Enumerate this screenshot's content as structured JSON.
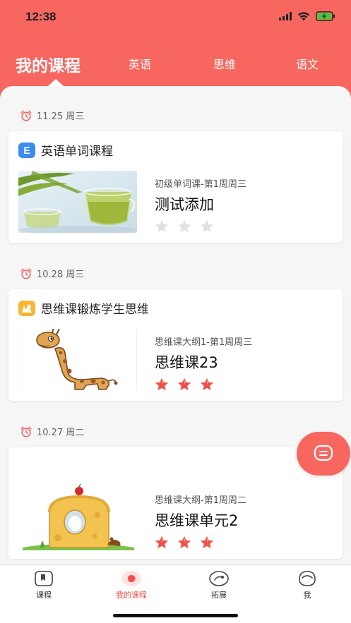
{
  "status_bar": {
    "time": "12:38"
  },
  "tabs": [
    {
      "label": "我的课程",
      "active": true
    },
    {
      "label": "英语",
      "active": false
    },
    {
      "label": "思维",
      "active": false
    },
    {
      "label": "语文",
      "active": false
    }
  ],
  "colors": {
    "brand": "#f7675f",
    "active_nav": "#f0524a",
    "star_filled": "#f0524a",
    "star_empty": "#e1e1e1"
  },
  "sessions": [
    {
      "date": "11.25 周三",
      "course_icon": "E",
      "course_title": "英语单词课程",
      "lesson_subtitle": "初级单词课-第1周周三",
      "lesson_title": "测试添加",
      "stars_filled": 0,
      "stars_total": 3,
      "thumbnail": "green-tea-image"
    },
    {
      "date": "10.28 周三",
      "course_icon": "thinking-badge-icon",
      "course_title": "思维课锻炼学生思维",
      "lesson_subtitle": "思维课大纲1-第1周周三",
      "lesson_title": "思维课23",
      "stars_filled": 3,
      "stars_total": 3,
      "thumbnail": "giraffe-image"
    },
    {
      "date": "10.27 周二",
      "lesson_subtitle": "思维课大纲-第1周周二",
      "lesson_title": "思维课单元2",
      "stars_filled": 3,
      "stars_total": 3,
      "thumbnail": "cheese-house-image"
    }
  ],
  "bottom_nav": [
    {
      "label": "课程",
      "icon": "course-icon",
      "active": false
    },
    {
      "label": "我的课程",
      "icon": "my-course-icon",
      "active": true
    },
    {
      "label": "拓展",
      "icon": "expand-icon",
      "active": false
    },
    {
      "label": "我",
      "icon": "profile-icon",
      "active": false
    }
  ]
}
